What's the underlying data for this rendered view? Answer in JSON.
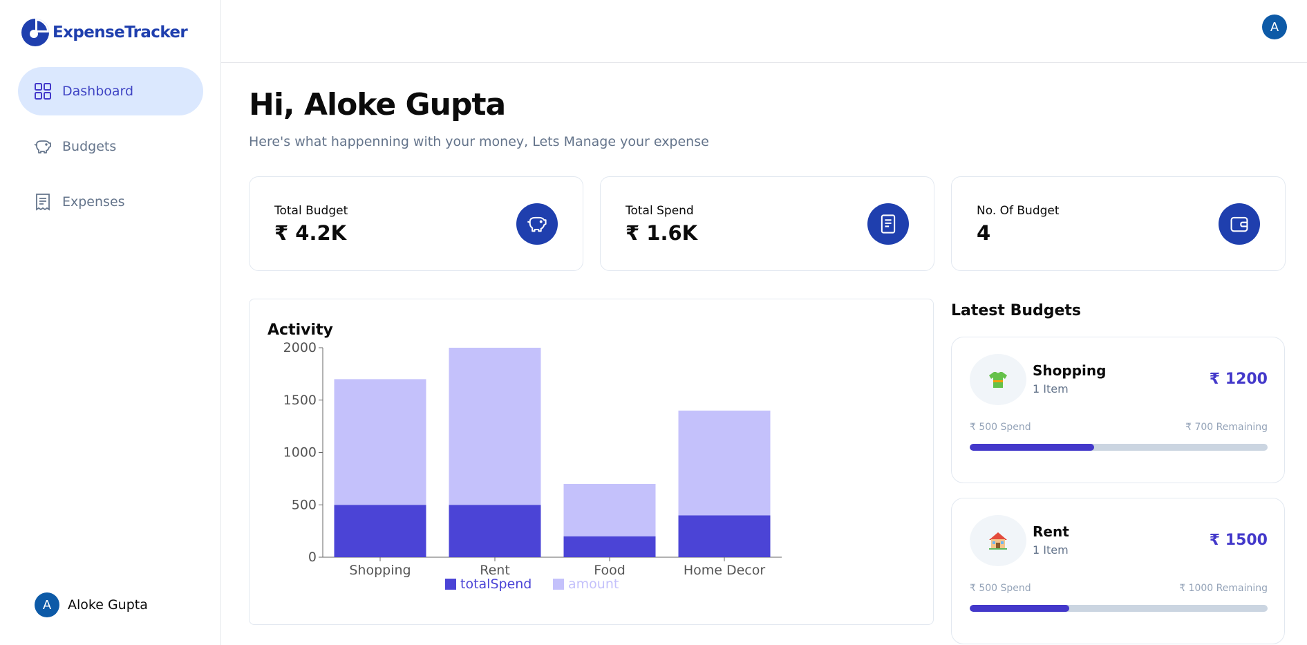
{
  "app": {
    "brand": "ExpenseTracker",
    "brand_color": "#1f3fae",
    "accent": "#4338ca"
  },
  "sidebar": {
    "items": [
      {
        "label": "Dashboard",
        "icon": "grid-icon",
        "active": true
      },
      {
        "label": "Budgets",
        "icon": "piggy-bank-icon",
        "active": false
      },
      {
        "label": "Expenses",
        "icon": "receipt-icon",
        "active": false
      }
    ],
    "user": {
      "name": "Aloke Gupta",
      "initial": "A"
    }
  },
  "header": {
    "avatar_initial": "A"
  },
  "main": {
    "greeting": "Hi, Aloke Gupta",
    "subtitle": "Here's what happenning with your money, Lets Manage your expense",
    "stats": [
      {
        "label": "Total Budget",
        "value": "₹ 4.2K",
        "icon": "piggy-bank-icon"
      },
      {
        "label": "Total Spend",
        "value": "₹ 1.6K",
        "icon": "receipt-icon"
      },
      {
        "label": "No. Of Budget",
        "value": "4",
        "icon": "wallet-icon"
      }
    ],
    "activity_title": "Activity",
    "latest_title": "Latest Budgets",
    "budgets": [
      {
        "name": "Shopping",
        "items": "1 Item",
        "amount": "₹ 1200",
        "spend": "₹ 500 Spend",
        "remaining": "₹ 700 Remaining",
        "progress": 0.4167,
        "icon": "tshirt-icon"
      },
      {
        "name": "Rent",
        "items": "1 Item",
        "amount": "₹ 1500",
        "spend": "₹ 500 Spend",
        "remaining": "₹ 1000 Remaining",
        "progress": 0.3333,
        "icon": "house-icon"
      }
    ]
  },
  "chart_data": {
    "type": "bar",
    "stacked": true,
    "categories": [
      "Shopping",
      "Rent",
      "Food",
      "Home Decor"
    ],
    "series": [
      {
        "name": "totalSpend",
        "values": [
          500,
          500,
          200,
          400
        ],
        "color": "#4b44d6"
      },
      {
        "name": "amount",
        "values": [
          1200,
          1500,
          500,
          1000
        ],
        "color": "#c4c1fb"
      }
    ],
    "ylim": [
      0,
      2000
    ],
    "yticks": [
      "0",
      "500",
      "1000",
      "1500",
      "2000"
    ],
    "legend": "bottom",
    "grid": false
  }
}
